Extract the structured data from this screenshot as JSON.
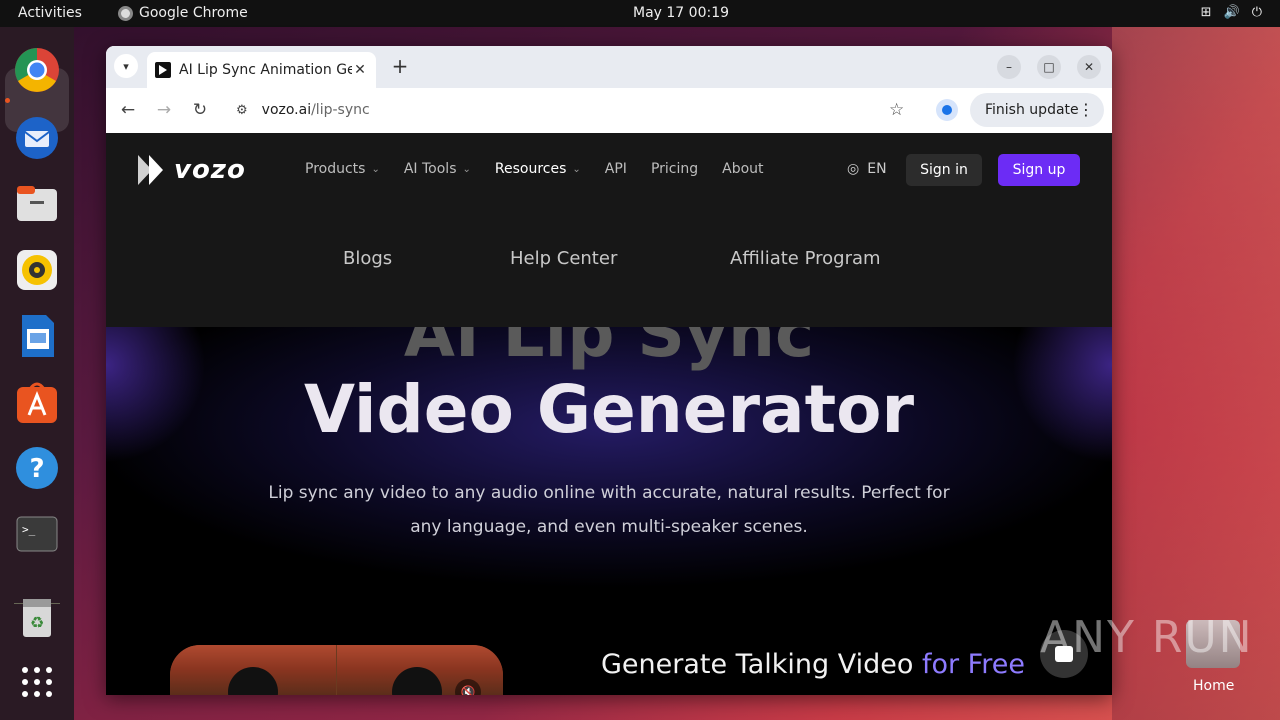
{
  "topbar": {
    "activities": "Activities",
    "app_name": "Google Chrome",
    "clock": "May 17  00:19"
  },
  "dock": {
    "items": [
      "chrome-icon",
      "thunderbird-icon",
      "files-icon",
      "rhythmbox-icon",
      "writer-icon",
      "app-center-icon",
      "help-icon",
      "terminal-icon",
      "trash-icon",
      "apps-grid-icon"
    ]
  },
  "browser": {
    "tab_title": "AI Lip Sync Animation Ge",
    "url_host": "vozo.ai",
    "url_path": "/lip-sync",
    "finish_update": "Finish update"
  },
  "site": {
    "logo_text": "vozo",
    "nav": [
      {
        "label": "Products",
        "dropdown": true
      },
      {
        "label": "AI Tools",
        "dropdown": true
      },
      {
        "label": "Resources",
        "dropdown": true,
        "active": true
      },
      {
        "label": "API",
        "dropdown": false
      },
      {
        "label": "Pricing",
        "dropdown": false
      },
      {
        "label": "About",
        "dropdown": false
      }
    ],
    "lang": "EN",
    "sign_in": "Sign in",
    "sign_up": "Sign up",
    "resources_menu": [
      "Blogs",
      "Help Center",
      "Affiliate Program"
    ]
  },
  "hero": {
    "title_line1": "AI Lip Sync",
    "title_line2": "Video Generator",
    "description": "Lip sync any video to any audio online with accurate, natural results. Perfect for any language, and even multi-speaker scenes.",
    "gen_title": "Generate Talking Video ",
    "gen_title_accent": "for Free"
  },
  "desktop": {
    "home_label": "Home",
    "watermark": "ANY RUN"
  }
}
